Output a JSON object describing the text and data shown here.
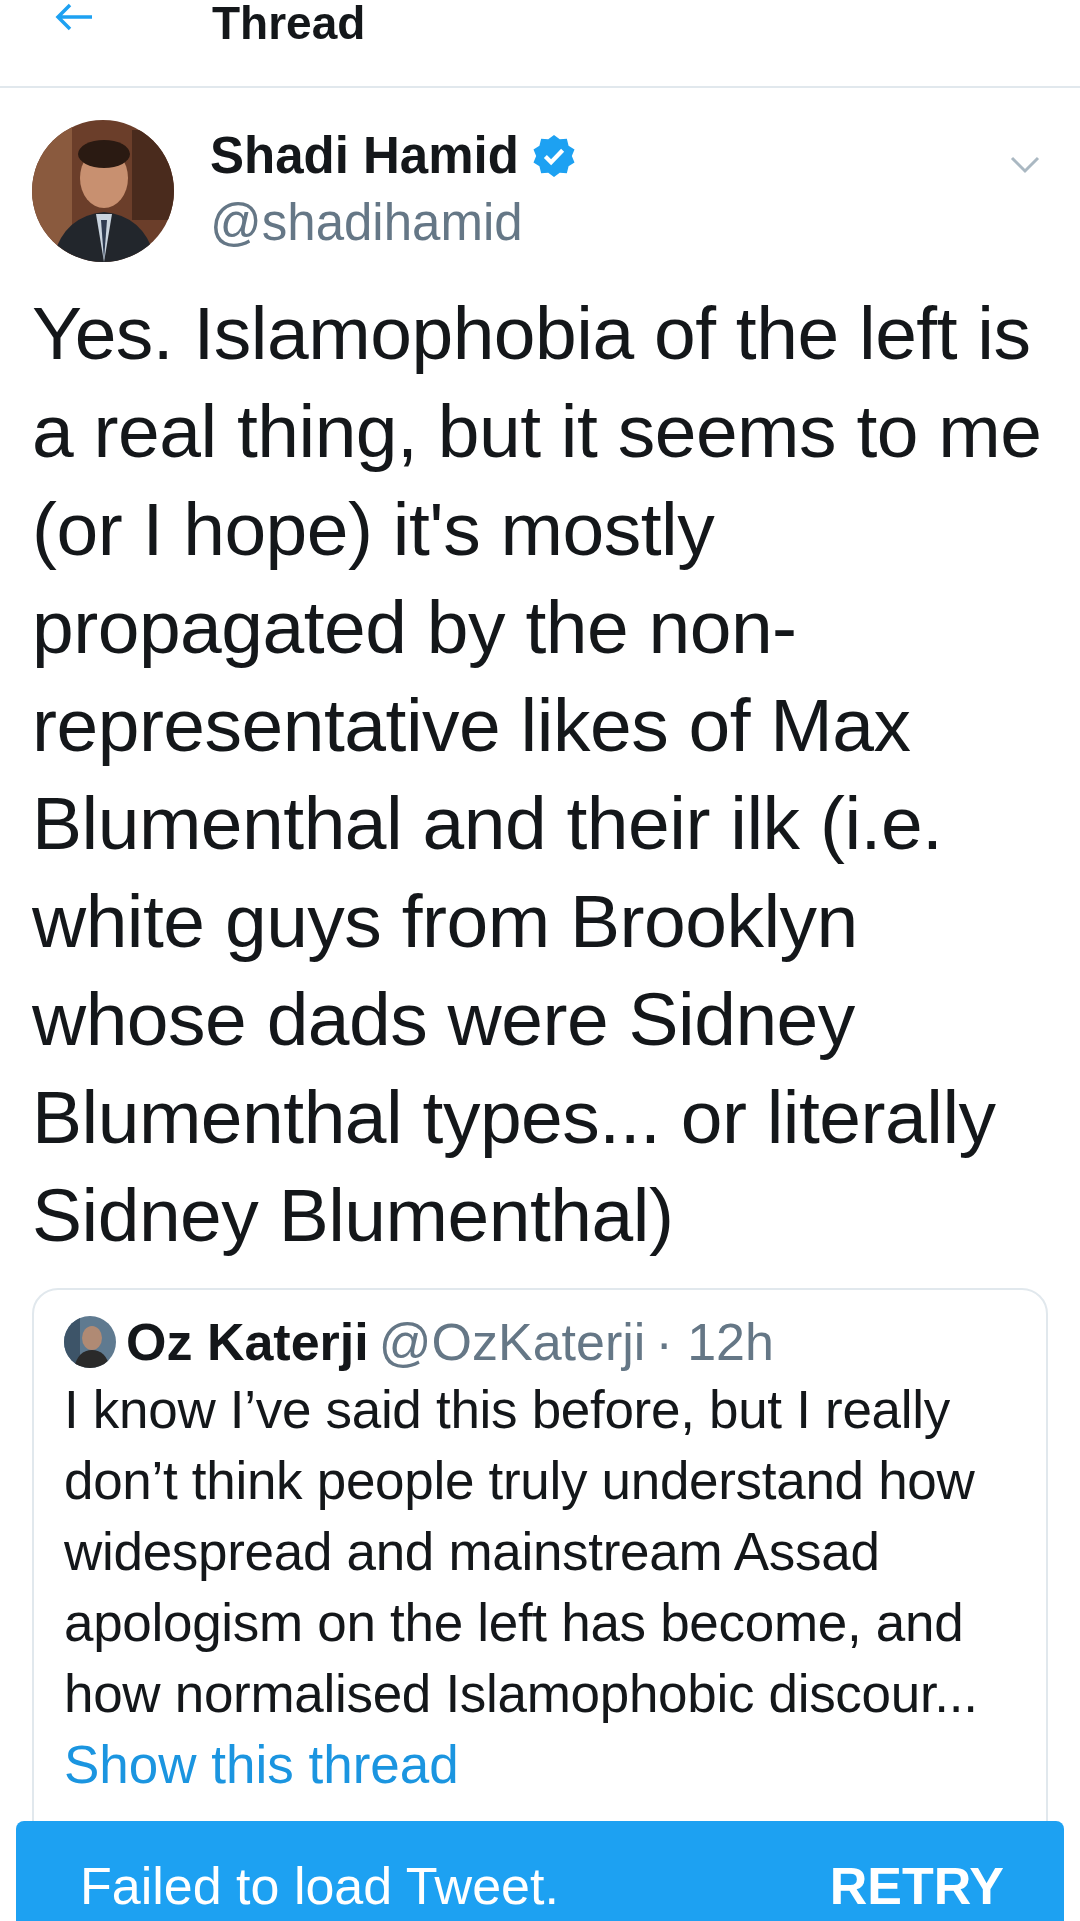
{
  "header": {
    "title": "Thread"
  },
  "tweet": {
    "author": {
      "name": "Shadi Hamid",
      "verified": true,
      "handle": "@shadihamid"
    },
    "text": "Yes. Islamophobia of the left is a real thing, but it seems to me (or I hope) it's mostly propagated by the non-representative likes of Max Blumenthal and their ilk (i.e. white guys from Brooklyn whose dads were Sidney Blumenthal types... or literally Sidney Blumenthal)",
    "quoted": {
      "name": "Oz Katerji",
      "handle": "@OzKaterji",
      "time": "· 12h",
      "text": "I know I’ve said this before, but I really don’t think people truly understand how widespread and mainstream Assad apologism on the left has become, and how normalised Islamophobic discour...",
      "link": "Show this thread"
    }
  },
  "snackbar": {
    "message": "Failed to load Tweet.",
    "action": "RETRY"
  }
}
